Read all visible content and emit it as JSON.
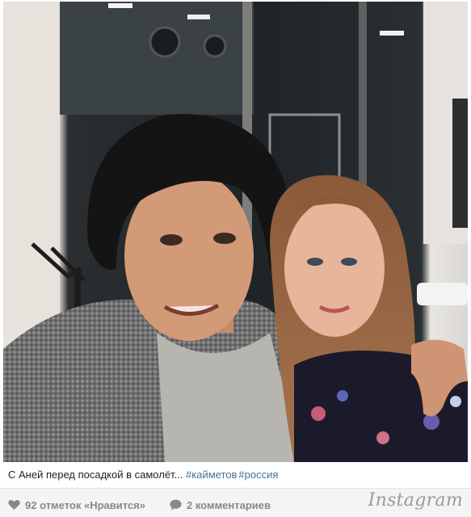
{
  "post": {
    "caption_text": "С Аней перед посадкой в самолёт...",
    "hashtags": [
      "#кайметов",
      "#россия"
    ]
  },
  "footer": {
    "likes_label": "92 отметок «Нравится»",
    "comments_label": "2 комментариев",
    "brand": "Instagram"
  },
  "colors": {
    "hashtag": "#3f729b",
    "footer_text": "#888888",
    "footer_bg": "#f4f4f4"
  },
  "icons": {
    "likes": "heart-icon",
    "comments": "speech-bubble-icon"
  }
}
